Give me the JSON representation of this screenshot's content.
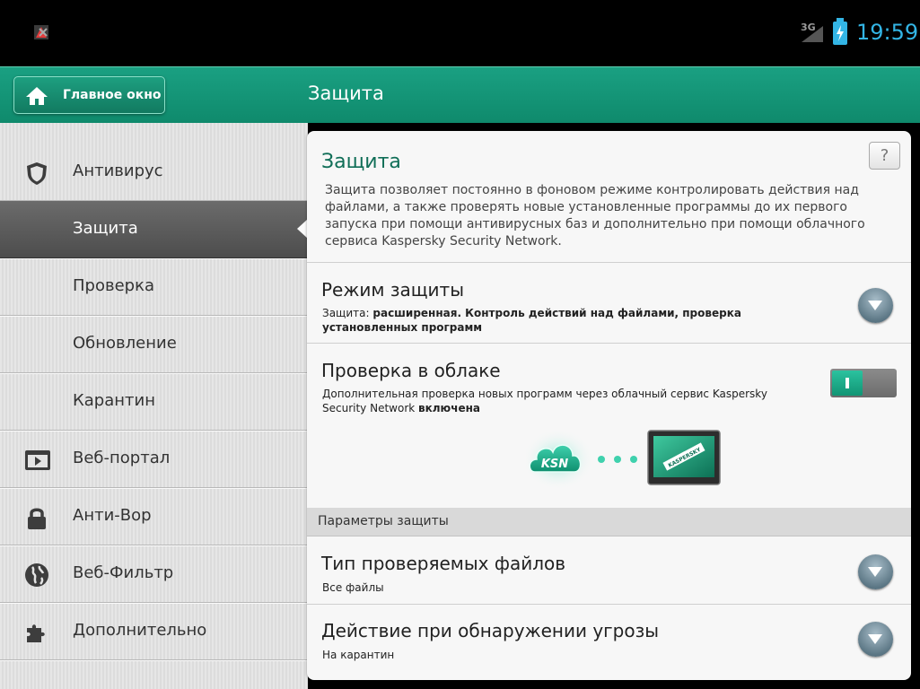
{
  "statusbar": {
    "network": "3G",
    "time": "19:59",
    "battery_color": "#33b5e5"
  },
  "header": {
    "home_label": "Главное окно",
    "title": "Защита",
    "accent": "#129074"
  },
  "sidebar": {
    "items": [
      {
        "label": "Антивирус",
        "icon": "shield-icon",
        "active": false
      },
      {
        "label": "Защита",
        "icon": "",
        "active": true
      },
      {
        "label": "Проверка",
        "icon": "",
        "active": false
      },
      {
        "label": "Обновление",
        "icon": "",
        "active": false
      },
      {
        "label": "Карантин",
        "icon": "",
        "active": false
      },
      {
        "label": "Веб-портал",
        "icon": "web-portal-icon",
        "active": false
      },
      {
        "label": "Анти-Вор",
        "icon": "lock-icon",
        "active": false
      },
      {
        "label": "Веб-Фильтр",
        "icon": "globe-icon",
        "active": false
      },
      {
        "label": "Дополнительно",
        "icon": "puzzle-icon",
        "active": false
      }
    ]
  },
  "main": {
    "help_label": "?",
    "title": "Защита",
    "description": "Защита позволяет постоянно в фоновом режиме контролировать действия над файлами, а также проверять новые установленные программы до их первого запуска при помощи антивирусных баз и дополнительно при помощи облачного сервиса Kaspersky Security Network.",
    "protection_mode": {
      "title": "Режим защиты",
      "sub_prefix": "Защита:",
      "sub_value": "расширенная. Контроль действий над файлами, проверка установленных программ"
    },
    "cloud_check": {
      "title": "Проверка в облаке",
      "sub_prefix": "Дополнительная проверка новых программ через облачный сервис Kaspersky Security Network",
      "sub_value": "включена",
      "toggle_on": true,
      "ksn_label": "KSN",
      "device_label": "KASPERSKY"
    },
    "params_header": "Параметры защиты",
    "file_types": {
      "title": "Тип проверяемых файлов",
      "value": "Все файлы"
    },
    "threat_action": {
      "title": "Действие при обнаружении угрозы",
      "value": "На карантин"
    }
  }
}
